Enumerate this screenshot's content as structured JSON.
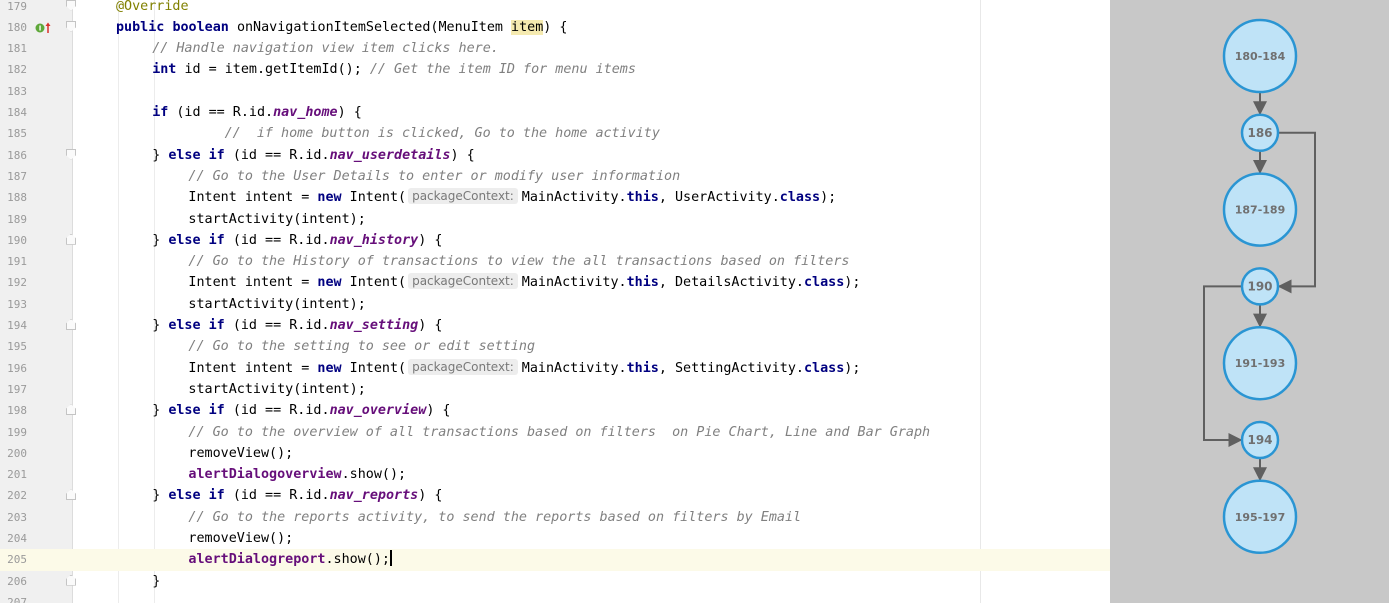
{
  "editor": {
    "current_line": 205,
    "rows": [
      {
        "num": "179",
        "indent": 0,
        "fold": "open",
        "icon": "",
        "tokens": [
          [
            "a",
            "@Override"
          ]
        ]
      },
      {
        "num": "180",
        "indent": 0,
        "fold": "open",
        "icon": "override-up-icon",
        "tokens": [
          [
            "k",
            "public "
          ],
          [
            "k",
            "boolean "
          ],
          [
            "p",
            "onNavigationItemSelected(MenuItem "
          ],
          [
            "hl",
            "item"
          ],
          [
            "p",
            ") {"
          ]
        ]
      },
      {
        "num": "181",
        "indent": 1,
        "fold": "",
        "icon": "",
        "tokens": [
          [
            "c",
            "// Handle navigation view item clicks here."
          ]
        ]
      },
      {
        "num": "182",
        "indent": 1,
        "fold": "",
        "icon": "",
        "tokens": [
          [
            "k",
            "int "
          ],
          [
            "p",
            "id = item.getItemId(); "
          ],
          [
            "c",
            "// Get the item ID for menu items"
          ]
        ]
      },
      {
        "num": "183",
        "indent": 0,
        "fold": "",
        "icon": "",
        "tokens": []
      },
      {
        "num": "184",
        "indent": 1,
        "fold": "",
        "icon": "",
        "tokens": [
          [
            "k",
            "if "
          ],
          [
            "p",
            "(id == R.id."
          ],
          [
            "f",
            "nav_home"
          ],
          [
            "p",
            ") {"
          ]
        ]
      },
      {
        "num": "185",
        "indent": 3,
        "fold": "",
        "icon": "",
        "tokens": [
          [
            "c",
            "//  if home button is clicked, Go to the home activity"
          ]
        ]
      },
      {
        "num": "186",
        "indent": 1,
        "fold": "open",
        "icon": "",
        "tokens": [
          [
            "p",
            "} "
          ],
          [
            "k",
            "else if "
          ],
          [
            "p",
            "(id == R.id."
          ],
          [
            "f",
            "nav_userdetails"
          ],
          [
            "p",
            ") {"
          ]
        ]
      },
      {
        "num": "187",
        "indent": 2,
        "fold": "",
        "icon": "",
        "tokens": [
          [
            "c",
            "// Go to the User Details to enter or modify user information"
          ]
        ]
      },
      {
        "num": "188",
        "indent": 2,
        "fold": "",
        "icon": "",
        "tokens": [
          [
            "p",
            "Intent intent = "
          ],
          [
            "k",
            "new "
          ],
          [
            "p",
            "Intent("
          ],
          [
            "hint",
            "packageContext:"
          ],
          [
            "p",
            "MainActivity."
          ],
          [
            "k",
            "this"
          ],
          [
            "p",
            ", UserActivity."
          ],
          [
            "k",
            "class"
          ],
          [
            "p",
            ");"
          ]
        ]
      },
      {
        "num": "189",
        "indent": 2,
        "fold": "",
        "icon": "",
        "tokens": [
          [
            "p",
            "startActivity(intent);"
          ]
        ]
      },
      {
        "num": "190",
        "indent": 1,
        "fold": "close",
        "icon": "",
        "tokens": [
          [
            "p",
            "} "
          ],
          [
            "k",
            "else if "
          ],
          [
            "p",
            "(id == R.id."
          ],
          [
            "f",
            "nav_history"
          ],
          [
            "p",
            ") {"
          ]
        ]
      },
      {
        "num": "191",
        "indent": 2,
        "fold": "",
        "icon": "",
        "tokens": [
          [
            "c",
            "// Go to the History of transactions to view the all transactions based on filters"
          ]
        ]
      },
      {
        "num": "192",
        "indent": 2,
        "fold": "",
        "icon": "",
        "tokens": [
          [
            "p",
            "Intent intent = "
          ],
          [
            "k",
            "new "
          ],
          [
            "p",
            "Intent("
          ],
          [
            "hint",
            "packageContext:"
          ],
          [
            "p",
            "MainActivity."
          ],
          [
            "k",
            "this"
          ],
          [
            "p",
            ", DetailsActivity."
          ],
          [
            "k",
            "class"
          ],
          [
            "p",
            ");"
          ]
        ]
      },
      {
        "num": "193",
        "indent": 2,
        "fold": "",
        "icon": "",
        "tokens": [
          [
            "p",
            "startActivity(intent);"
          ]
        ]
      },
      {
        "num": "194",
        "indent": 1,
        "fold": "close",
        "icon": "",
        "tokens": [
          [
            "p",
            "} "
          ],
          [
            "k",
            "else if "
          ],
          [
            "p",
            "(id == R.id."
          ],
          [
            "f",
            "nav_setting"
          ],
          [
            "p",
            ") {"
          ]
        ]
      },
      {
        "num": "195",
        "indent": 2,
        "fold": "",
        "icon": "",
        "tokens": [
          [
            "c",
            "// Go to the setting to see or edit setting"
          ]
        ]
      },
      {
        "num": "196",
        "indent": 2,
        "fold": "",
        "icon": "",
        "tokens": [
          [
            "p",
            "Intent intent = "
          ],
          [
            "k",
            "new "
          ],
          [
            "p",
            "Intent("
          ],
          [
            "hint",
            "packageContext:"
          ],
          [
            "p",
            "MainActivity."
          ],
          [
            "k",
            "this"
          ],
          [
            "p",
            ", SettingActivity."
          ],
          [
            "k",
            "class"
          ],
          [
            "p",
            ");"
          ]
        ]
      },
      {
        "num": "197",
        "indent": 2,
        "fold": "",
        "icon": "",
        "tokens": [
          [
            "p",
            "startActivity(intent);"
          ]
        ]
      },
      {
        "num": "198",
        "indent": 1,
        "fold": "close",
        "icon": "",
        "tokens": [
          [
            "p",
            "} "
          ],
          [
            "k",
            "else if "
          ],
          [
            "p",
            "(id == R.id."
          ],
          [
            "f",
            "nav_overview"
          ],
          [
            "p",
            ") {"
          ]
        ]
      },
      {
        "num": "199",
        "indent": 2,
        "fold": "",
        "icon": "",
        "tokens": [
          [
            "c",
            "// Go to the overview of all transactions based on filters  on Pie Chart, Line and Bar Graph"
          ]
        ]
      },
      {
        "num": "200",
        "indent": 2,
        "fold": "",
        "icon": "",
        "tokens": [
          [
            "p",
            "removeView();"
          ]
        ]
      },
      {
        "num": "201",
        "indent": 2,
        "fold": "",
        "icon": "",
        "tokens": [
          [
            "s",
            "alertDialogoverview"
          ],
          [
            "p",
            ".show();"
          ]
        ]
      },
      {
        "num": "202",
        "indent": 1,
        "fold": "close",
        "icon": "",
        "tokens": [
          [
            "p",
            "} "
          ],
          [
            "k",
            "else if "
          ],
          [
            "p",
            "(id == R.id."
          ],
          [
            "f",
            "nav_reports"
          ],
          [
            "p",
            ") {"
          ]
        ]
      },
      {
        "num": "203",
        "indent": 2,
        "fold": "",
        "icon": "",
        "tokens": [
          [
            "c",
            "// Go to the reports activity, to send the reports based on filters by Email"
          ]
        ]
      },
      {
        "num": "204",
        "indent": 2,
        "fold": "",
        "icon": "",
        "tokens": [
          [
            "p",
            "removeView();"
          ]
        ]
      },
      {
        "num": "205",
        "indent": 2,
        "fold": "",
        "icon": "",
        "tokens": [
          [
            "s",
            "alertDialogreport"
          ],
          [
            "p",
            ".show();"
          ],
          [
            "caret",
            ""
          ]
        ]
      },
      {
        "num": "206",
        "indent": 1,
        "fold": "close",
        "icon": "",
        "tokens": [
          [
            "p",
            "}"
          ]
        ]
      },
      {
        "num": "207",
        "indent": 0,
        "fold": "",
        "icon": "",
        "tokens": []
      }
    ]
  },
  "flow_graph": {
    "nodes": [
      {
        "id": "n1",
        "label": "180-184",
        "size": "large"
      },
      {
        "id": "n2",
        "label": "186",
        "size": "small"
      },
      {
        "id": "n3",
        "label": "187-189",
        "size": "large"
      },
      {
        "id": "n4",
        "label": "190",
        "size": "small"
      },
      {
        "id": "n5",
        "label": "191-193",
        "size": "large"
      },
      {
        "id": "n6",
        "label": "194",
        "size": "small"
      },
      {
        "id": "n7",
        "label": "195-197",
        "size": "large"
      }
    ],
    "edges": [
      {
        "from": "n1",
        "to": "n2"
      },
      {
        "from": "n2",
        "to": "n3"
      },
      {
        "from": "n2",
        "to": "n4"
      },
      {
        "from": "n4",
        "to": "n5"
      },
      {
        "from": "n4",
        "to": "n6"
      },
      {
        "from": "n6",
        "to": "n7"
      }
    ],
    "colors": {
      "node_fill": "#bfe3f7",
      "node_stroke": "#2a95d3",
      "edge": "#606060",
      "background": "#c8c8c8",
      "label": "#707070"
    }
  }
}
